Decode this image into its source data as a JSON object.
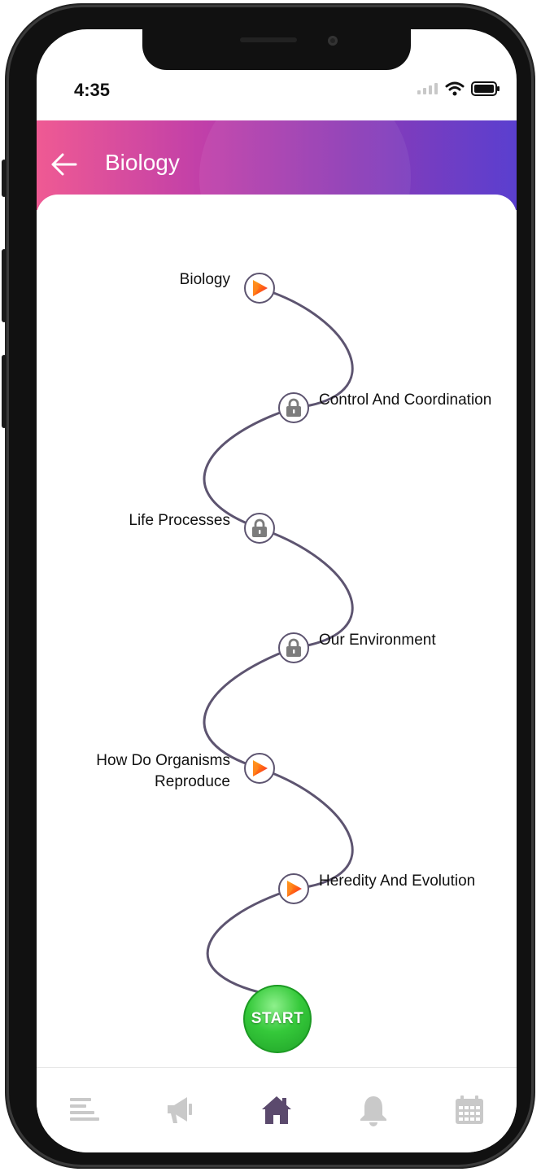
{
  "status_bar": {
    "time": "4:35"
  },
  "header": {
    "title": "Biology"
  },
  "topics": [
    {
      "label": "Biology",
      "status": "play"
    },
    {
      "label": "Control And Coordination",
      "status": "locked"
    },
    {
      "label": "Life Processes",
      "status": "locked"
    },
    {
      "label": "Our Environment",
      "status": "locked"
    },
    {
      "label": "How Do Organisms Reproduce",
      "status": "play"
    },
    {
      "label": "Heredity And Evolution",
      "status": "play"
    }
  ],
  "start_button": {
    "label": "START"
  },
  "bottom_nav": [
    {
      "icon": "menu-icon",
      "active": false
    },
    {
      "icon": "megaphone-icon",
      "active": false
    },
    {
      "icon": "home-icon",
      "active": true
    },
    {
      "icon": "bell-icon",
      "active": false
    },
    {
      "icon": "calendar-icon",
      "active": false
    }
  ],
  "colors": {
    "header_gradient_start": "#ef5a93",
    "header_gradient_end": "#5a3fcf",
    "path": "#5d5470",
    "start_green": "#35c93a",
    "nav_inactive": "#c9c9c9",
    "nav_active": "#5b4a6d"
  }
}
